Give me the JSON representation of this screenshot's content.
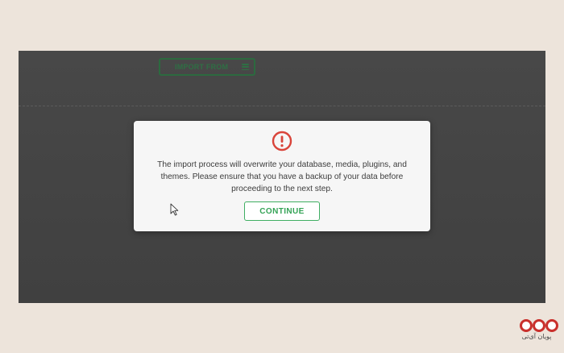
{
  "toolbar": {
    "import_label": "IMPORT FROM",
    "import_menu_icon": "hamburger-menu-icon"
  },
  "modal": {
    "icon": "exclamation-circle-icon",
    "message": "The import process will overwrite your database, media, plugins, and themes. Please ensure that you have a backup of your data before proceeding to the next step.",
    "continue_label": "CONTINUE"
  },
  "watermark": {
    "logo_icon": "three-red-circles-logo",
    "text": "پویان آی‌تی"
  },
  "colors": {
    "page_background": "#ede4db",
    "screen_background": "#444444",
    "modal_background": "#f6f6f6",
    "import_accent": "#2f6f44",
    "continue_accent": "#34a356",
    "alert_red": "#d9443a",
    "logo_red": "#c9302c"
  }
}
